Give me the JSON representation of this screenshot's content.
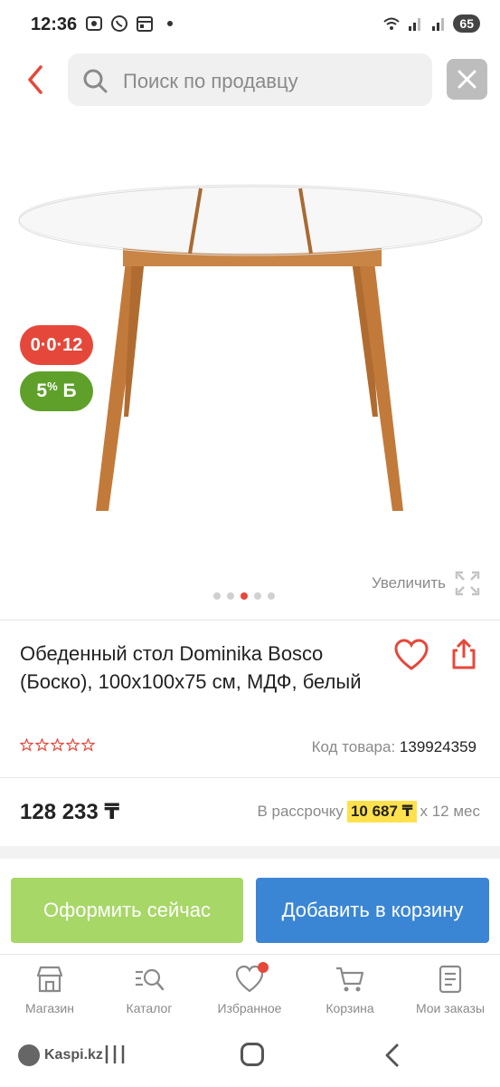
{
  "status_bar": {
    "time": "12:36",
    "battery": "65",
    "icons": [
      "gallery-notification-icon",
      "whatsapp-icon",
      "calendar-icon",
      "dot-icon",
      "wifi-icon",
      "signal-icon",
      "signal-icon"
    ]
  },
  "header": {
    "search_placeholder": "Поиск по продавцу"
  },
  "product": {
    "badges": {
      "installment": "0·0·12",
      "bonus_value": "5",
      "bonus_percent": "%",
      "bonus_currency": "Б"
    },
    "zoom_label": "Увеличить",
    "gallery": {
      "count": 5,
      "active_index": 2
    },
    "title": "Обеденный стол Dominika Bosco (Боско), 100x100x75 см, МДФ, белый",
    "rating_stars": 0,
    "code_label": "Код товара:",
    "code_value": "139924359",
    "price": "128 233 ₸",
    "installment_label": "В рассрочку",
    "installment_amount": "10 687 ₸",
    "installment_term": "x 12 мес"
  },
  "actions": {
    "checkout": "Оформить сейчас",
    "add_to_cart": "Добавить в корзину"
  },
  "nav": {
    "items": [
      {
        "label": "Магазин",
        "icon": "shop-icon"
      },
      {
        "label": "Каталог",
        "icon": "catalog-icon"
      },
      {
        "label": "Избранное",
        "icon": "heart-icon"
      },
      {
        "label": "Корзина",
        "icon": "cart-icon"
      },
      {
        "label": "Мои заказы",
        "icon": "orders-icon"
      }
    ]
  },
  "system": {
    "watermark": "Kaspi.kz"
  },
  "colors": {
    "accent_red": "#e5483a",
    "bonus_green": "#5fa02a",
    "checkout_green": "#a7d766",
    "cart_blue": "#3a86d4",
    "installment_highlight": "#ffe14d"
  }
}
